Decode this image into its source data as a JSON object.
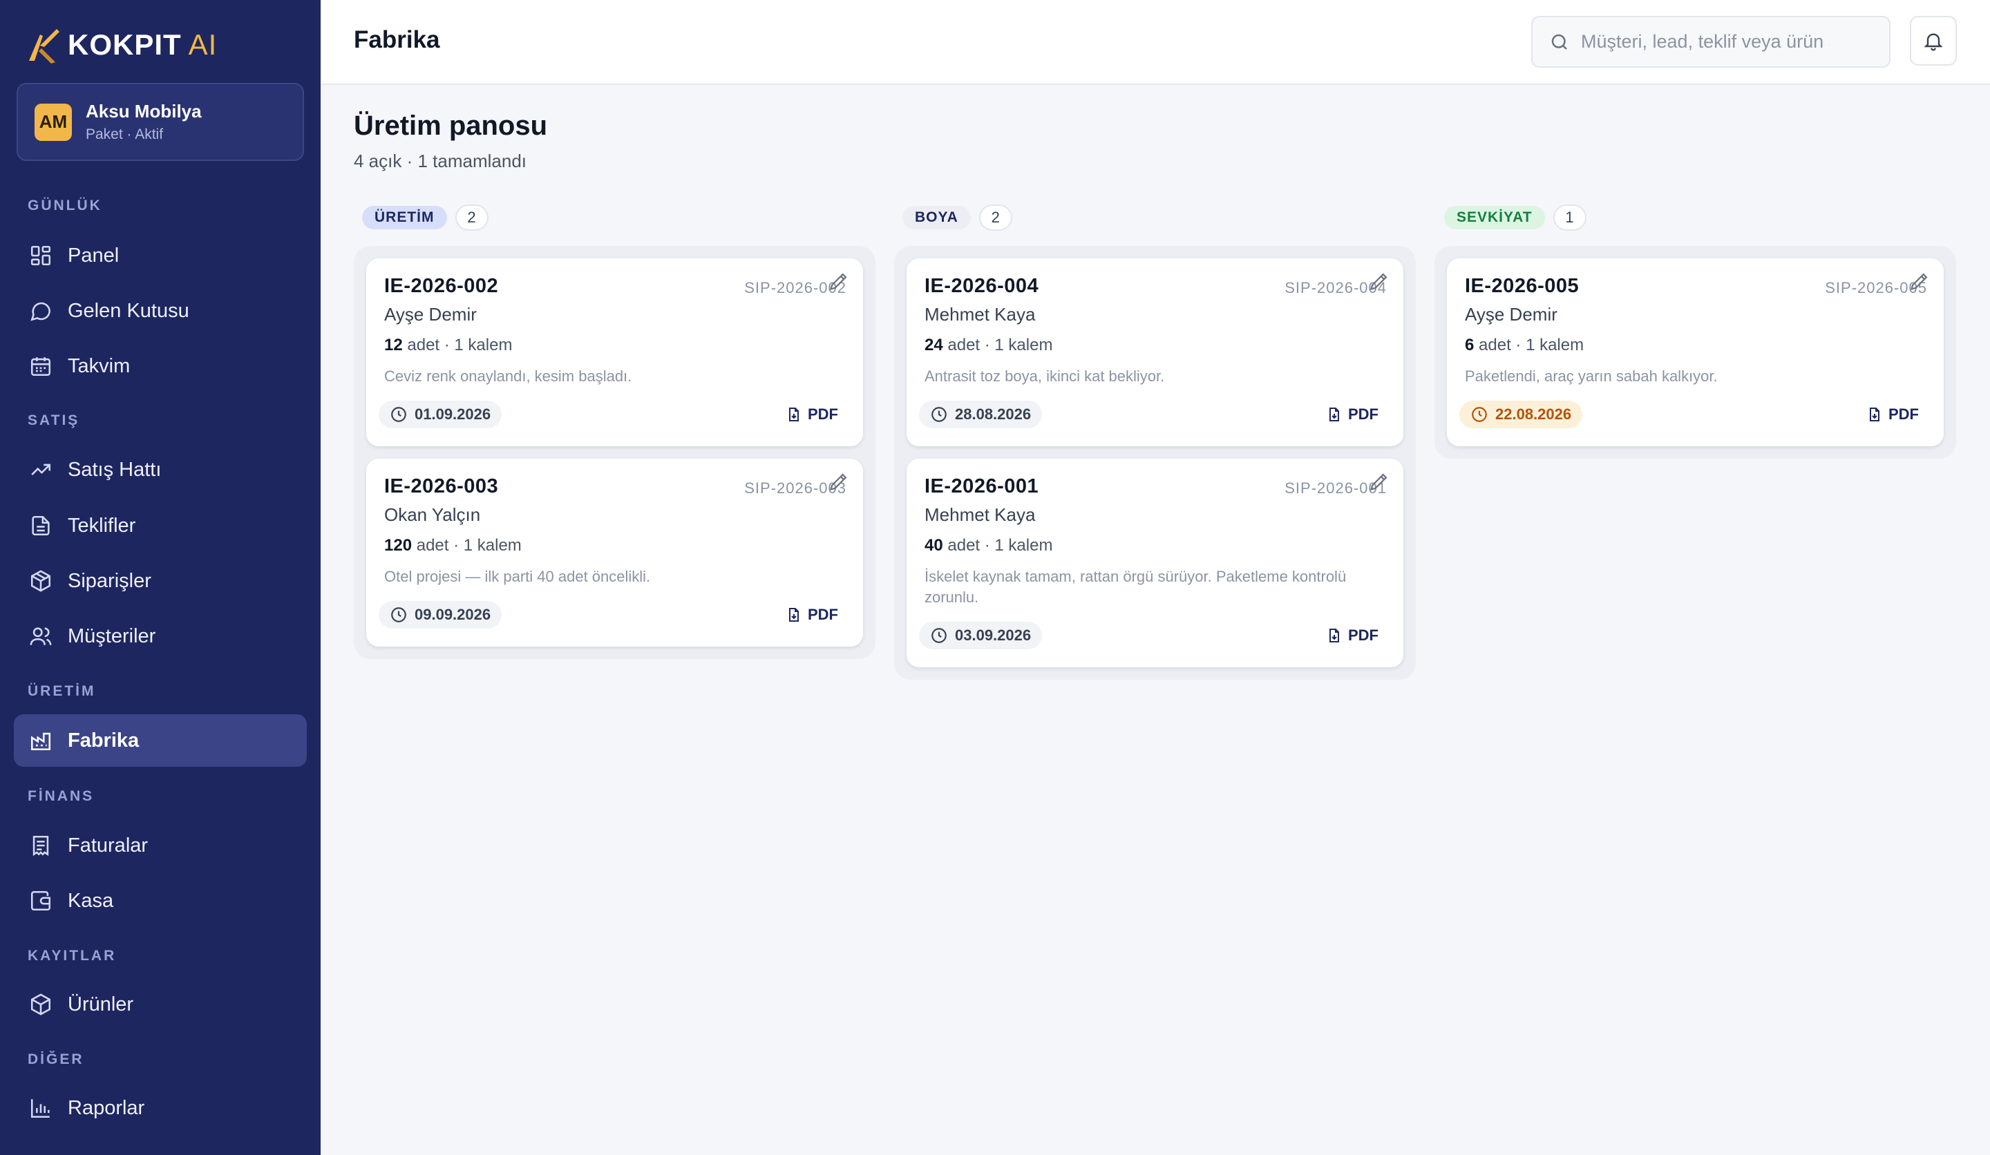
{
  "brand": {
    "name": "KOKPIT",
    "suffix": "AI",
    "accent": "#f2b74a",
    "sidebar_bg": "#1e2660"
  },
  "tenant": {
    "initials": "AM",
    "name": "Aksu Mobilya",
    "plan": "Paket · Aktif"
  },
  "sidebar": {
    "sections": [
      {
        "title": "GÜNLÜK",
        "items": [
          {
            "label": "Panel",
            "icon": "dashboard-icon"
          },
          {
            "label": "Gelen Kutusu",
            "icon": "chat-bubble-icon"
          },
          {
            "label": "Takvim",
            "icon": "calendar-icon"
          }
        ]
      },
      {
        "title": "SATIŞ",
        "items": [
          {
            "label": "Satış Hattı",
            "icon": "trending-up-icon"
          },
          {
            "label": "Teklifler",
            "icon": "document-icon"
          },
          {
            "label": "Siparişler",
            "icon": "package-icon"
          },
          {
            "label": "Müşteriler",
            "icon": "users-icon"
          }
        ]
      },
      {
        "title": "ÜRETİM",
        "items": [
          {
            "label": "Fabrika",
            "icon": "factory-icon",
            "active": true
          }
        ]
      },
      {
        "title": "FİNANS",
        "items": [
          {
            "label": "Faturalar",
            "icon": "invoice-icon"
          },
          {
            "label": "Kasa",
            "icon": "wallet-icon"
          }
        ]
      },
      {
        "title": "KAYITLAR",
        "items": [
          {
            "label": "Ürünler",
            "icon": "box-icon"
          }
        ]
      },
      {
        "title": "DİĞER",
        "items": [
          {
            "label": "Raporlar",
            "icon": "bar-chart-icon"
          }
        ]
      }
    ]
  },
  "header": {
    "title": "Fabrika",
    "search_placeholder": "Müşteri, lead, teklif veya ürün a",
    "search_icon": "search-icon",
    "bell_icon": "bell-icon"
  },
  "board": {
    "title": "Üretim panosu",
    "subtitle": "4 açık · 1 tamamlandı",
    "columns": [
      {
        "stage": "ÜRETİM",
        "count": "2",
        "color": "#1e2660",
        "bg": "#d7defa",
        "cards": [
          {
            "id": "IE-2026-002",
            "order": "SIP-2026-002",
            "customer": "Ayşe Demir",
            "qty": "12",
            "qty_rest": "adet · 1 kalem",
            "note": "Ceviz renk onaylandı, kesim başladı.",
            "date": "01.09.2026",
            "pdf": "PDF",
            "overdue": false
          },
          {
            "id": "IE-2026-003",
            "order": "SIP-2026-003",
            "customer": "Okan Yalçın",
            "qty": "120",
            "qty_rest": "adet · 1 kalem",
            "note": "Otel projesi — ilk parti 40 adet öncelikli.",
            "date": "09.09.2026",
            "pdf": "PDF",
            "overdue": false
          }
        ]
      },
      {
        "stage": "BOYA",
        "count": "2",
        "color": "#1e2660",
        "bg": "#eceef4",
        "cards": [
          {
            "id": "IE-2026-004",
            "order": "SIP-2026-004",
            "customer": "Mehmet Kaya",
            "qty": "24",
            "qty_rest": "adet · 1 kalem",
            "note": "Antrasit toz boya, ikinci kat bekliyor.",
            "date": "28.08.2026",
            "pdf": "PDF",
            "overdue": false
          },
          {
            "id": "IE-2026-001",
            "order": "SIP-2026-001",
            "customer": "Mehmet Kaya",
            "qty": "40",
            "qty_rest": "adet · 1 kalem",
            "note": "İskelet kaynak tamam, rattan örgü sürüyor. Paketleme kontrolü zorunlu.",
            "date": "03.09.2026",
            "pdf": "PDF",
            "overdue": false
          }
        ]
      },
      {
        "stage": "SEVKİYAT",
        "count": "1",
        "color": "#15803d",
        "bg": "#dcf5e3",
        "cards": [
          {
            "id": "IE-2026-005",
            "order": "SIP-2026-005",
            "customer": "Ayşe Demir",
            "qty": "6",
            "qty_rest": "adet · 1 kalem",
            "note": "Paketlendi, araç yarın sabah kalkıyor.",
            "date": "22.08.2026",
            "pdf": "PDF",
            "overdue": true
          }
        ]
      }
    ]
  }
}
